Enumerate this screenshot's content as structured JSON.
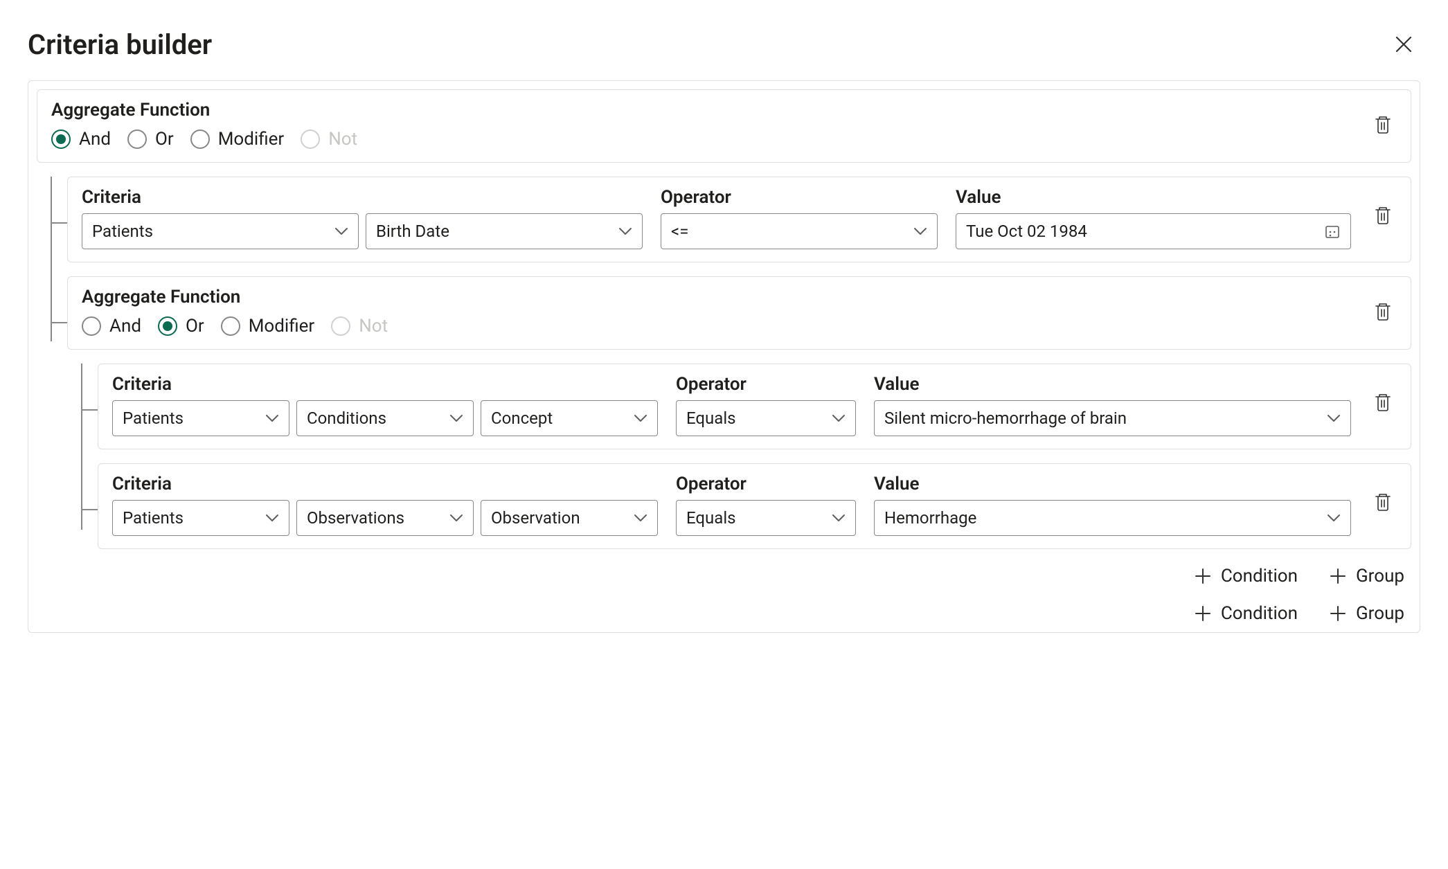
{
  "title": "Criteria builder",
  "labels": {
    "aggregate": "Aggregate Function",
    "criteria": "Criteria",
    "operator": "Operator",
    "value": "Value",
    "condition": "Condition",
    "group": "Group"
  },
  "radioOptions": {
    "and": "And",
    "or": "Or",
    "modifier": "Modifier",
    "not": "Not"
  },
  "group0": {
    "selected": "and",
    "row0": {
      "criteria": [
        "Patients",
        "Birth Date"
      ],
      "operator": "<=",
      "value": "Tue Oct 02 1984"
    },
    "group1": {
      "selected": "or",
      "row0": {
        "criteria": [
          "Patients",
          "Conditions",
          "Concept"
        ],
        "operator": "Equals",
        "value": "Silent micro-hemorrhage of brain"
      },
      "row1": {
        "criteria": [
          "Patients",
          "Observations",
          "Observation"
        ],
        "operator": "Equals",
        "value": "Hemorrhage"
      }
    }
  }
}
